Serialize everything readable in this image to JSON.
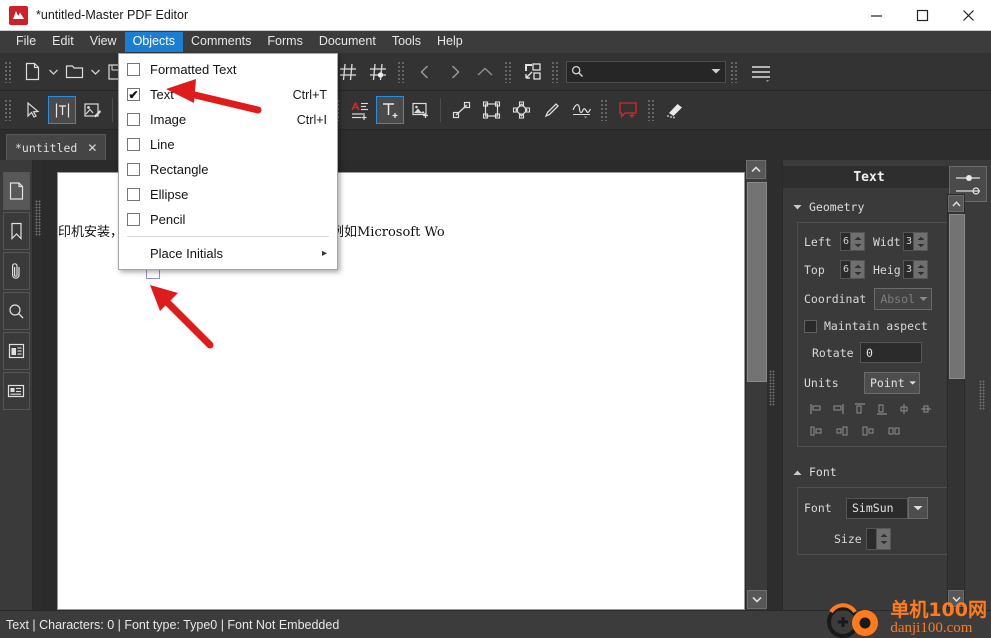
{
  "window": {
    "title": "*untitled-Master PDF Editor",
    "logo_text": "M",
    "minimize": "minimize-button",
    "maximize": "maximize-button",
    "close": "close-button"
  },
  "menubar": {
    "items": [
      {
        "label": "File",
        "active": false
      },
      {
        "label": "Edit",
        "active": false
      },
      {
        "label": "View",
        "active": false
      },
      {
        "label": "Objects",
        "active": true
      },
      {
        "label": "Comments",
        "active": false
      },
      {
        "label": "Forms",
        "active": false
      },
      {
        "label": "Document",
        "active": false
      },
      {
        "label": "Tools",
        "active": false
      },
      {
        "label": "Help",
        "active": false
      }
    ]
  },
  "objects_menu": {
    "items": [
      {
        "label": "Formatted Text",
        "accel": "",
        "checked": false,
        "submenu": false
      },
      {
        "label": "Text",
        "accel": "Ctrl+T",
        "checked": true,
        "submenu": false
      },
      {
        "label": "Image",
        "accel": "Ctrl+I",
        "checked": false,
        "submenu": false
      },
      {
        "label": "Line",
        "accel": "",
        "checked": false,
        "submenu": false
      },
      {
        "label": "Rectangle",
        "accel": "",
        "checked": false,
        "submenu": false
      },
      {
        "label": "Ellipse",
        "accel": "",
        "checked": false,
        "submenu": false
      },
      {
        "label": "Pencil",
        "accel": "",
        "checked": false,
        "submenu": false
      }
    ],
    "footer_item": {
      "label": "Place Initials",
      "submenu_arrow": "▸"
    },
    "check_glyph": "✔"
  },
  "toolbar_row1": {
    "icons": [
      "new-document-icon",
      "new-document-dropdown",
      "open-folder-icon",
      "open-folder-dropdown",
      "save-icon",
      "print-icon",
      "copy-icon",
      "paste-icon",
      "delete-icon",
      "undo-icon",
      "redo-icon",
      "grid-icon",
      "snap-to-grid-icon",
      "previous-page-icon",
      "next-page-icon",
      "page-up-icon",
      "fit-page-icon",
      "search-icon",
      "menu-icon"
    ],
    "search_placeholder": ""
  },
  "toolbar_row2": {
    "icons": [
      "select-tool-icon",
      "edit-text-tool-icon",
      "edit-image-tool-icon",
      "form-field-icon",
      "submit-button-icon",
      "checkbox-field-icon",
      "combobox-field-icon",
      "list-field-icon",
      "digital-signature-icon",
      "radio-button-icon",
      "push-button-icon",
      "text-style-icon",
      "add-text-icon",
      "add-image-icon",
      "line-tool-icon",
      "rectangle-tool-icon",
      "polygon-tool-icon",
      "pencil-tool-icon",
      "signature-tool-icon",
      "comment-box-icon",
      "highlight-icon"
    ],
    "selected": "add-text-icon"
  },
  "tabs": [
    {
      "label": "*untitled",
      "close": "✕",
      "active": true
    }
  ],
  "left_rail": {
    "items": [
      {
        "name": "pages-panel",
        "active": true
      },
      {
        "name": "bookmarks-panel",
        "active": false
      },
      {
        "name": "attachments-panel",
        "active": false
      },
      {
        "name": "search-panel",
        "active": false
      },
      {
        "name": "layers-panel",
        "active": false
      },
      {
        "name": "signatures-panel",
        "active": false
      }
    ]
  },
  "document": {
    "body_text": "印机安装，允许您从支持打印的不同应用程序（例如Microsoft Wo"
  },
  "right_panel": {
    "title": "Text",
    "geometry": {
      "section_label": "Geometry",
      "expanded": true,
      "left_label": "Left",
      "left_value": "6",
      "width_label": "Widt",
      "width_value": "3",
      "top_label": "Top",
      "top_value": "6",
      "height_label": "Heig",
      "height_value": "3",
      "coordinates_label": "Coordinat",
      "coordinates_value": "Absol",
      "maintain_aspect_label": "Maintain aspect",
      "maintain_aspect_checked": false,
      "rotate_label": "Rotate",
      "rotate_value": "0",
      "units_label": "Units",
      "units_value": "Point",
      "align_icons_row1": [
        "align-left-icon",
        "align-right-icon",
        "align-top-icon",
        "align-bottom-icon",
        "align-center-horizontal-icon",
        "align-center-vertical-icon"
      ],
      "align_icons_row2": [
        "distribute-left-icon",
        "distribute-center-icon",
        "distribute-right-icon",
        "distribute-even-icon"
      ]
    },
    "font": {
      "section_label": "Font",
      "expanded": true,
      "font_label": "Font",
      "font_value": "SimSun",
      "size_label": "Size"
    }
  },
  "statusbar": {
    "text": "Text | Characters: 0 | Font type: Type0 | Font Not Embedded"
  },
  "watermark": {
    "cn": "单机100网",
    "en": "danji100.com",
    "color": "#ff7b1c"
  },
  "colors": {
    "accent": "#1a7fd4",
    "chrome": "#3c3c3c",
    "toolbar": "#333333",
    "panel": "#3a3a3a",
    "canvas": "#2b2b2b",
    "annotation_arrow": "#e01b1b",
    "selection_border": "#2a8fe0"
  }
}
